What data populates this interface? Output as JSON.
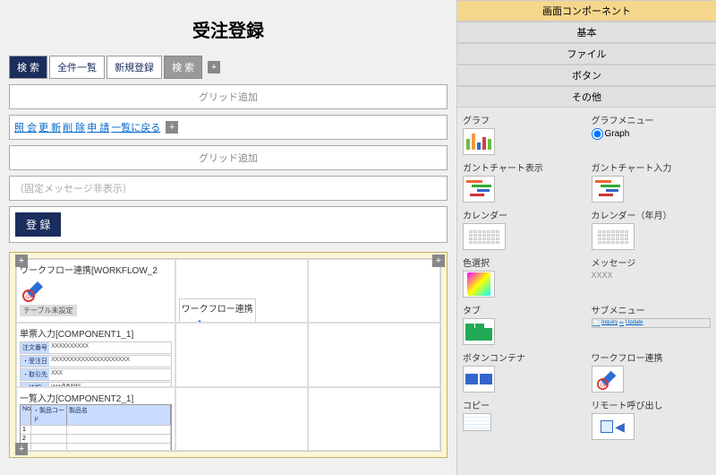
{
  "title": "受注登録",
  "tabs": {
    "search": "検 索",
    "all": "全件一覧",
    "new": "新規登録",
    "search2": "検 索"
  },
  "grid_add": "グリッド追加",
  "links": {
    "inquiry": "照 会",
    "update": "更 新",
    "delete": "削 除",
    "apply": "申 請",
    "back": "一覧に戻る"
  },
  "fixed_msg": "（固定メッセージ非表示）",
  "register_btn": "登 録",
  "canvas": {
    "wf1": "ワークフロー連携[WORKFLOW_2",
    "wf1_unset": "テーブル未設定",
    "wf2": "ワークフロー連携",
    "comp1": "単票入力[COMPONENT1_1]",
    "comp1_rows": {
      "r1_lbl": "注文番号",
      "r1_val": "XXXXXXXXXX",
      "r2_lbl": "・受注日",
      "r2_val": "XXXXXXXXXXXXXXXXXXXXX",
      "r3_lbl": "・取引先",
      "r3_val": "XXX",
      "r4_lbl": "・納期",
      "r4_val": "yyyy/MM/dd"
    },
    "comp2": "一覧入力[COMPONENT2_1]",
    "comp2_cols": {
      "c1": "No.",
      "c2": "・製品コード",
      "c3": "製品名"
    }
  },
  "panel": {
    "header": "画面コンポーネント",
    "cat_basic": "基本",
    "cat_file": "ファイル",
    "cat_button": "ボタン",
    "cat_other": "その他",
    "items": {
      "graph": "グラフ",
      "graph_menu": "グラフメニュー",
      "graph_radio": "Graph",
      "gantt_disp": "ガントチャート表示",
      "gantt_input": "ガントチャート入力",
      "calendar": "カレンダー",
      "calendar_ym": "カレンダー（年月）",
      "color": "色選択",
      "message": "メッセージ",
      "message_note": "XXXX",
      "tab": "タブ",
      "submenu": "サブメニュー",
      "submenu_i1": "Inquiry",
      "submenu_i2": "Update",
      "btn_container": "ボタンコンテナ",
      "workflow": "ワークフロー連携",
      "copy": "コピー",
      "remote": "リモート呼び出し"
    }
  }
}
